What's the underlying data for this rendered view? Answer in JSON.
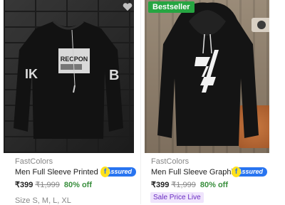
{
  "products": [
    {
      "brand": "FastColors",
      "title": "Men Full Sleeve Printed ...",
      "assured_label": "Assured",
      "price": "₹399",
      "mrp": "₹1,999",
      "discount": "80% off",
      "sizes": "Size S, M, L, XL",
      "print_text_1": "RECPON",
      "print_text_2": "IK",
      "print_text_3": "B"
    },
    {
      "badge": "Bestseller",
      "brand": "FastColors",
      "title": "Men Full Sleeve Graphic...",
      "assured_label": "Assured",
      "price": "₹399",
      "mrp": "₹1,999",
      "discount": "80% off",
      "sale_tag": "Sale Price Live"
    }
  ],
  "colors": {
    "badge_green": "#26a541",
    "assured_blue": "#2874f0",
    "discount_green": "#388e3c",
    "sale_purple": "#6b2ec3"
  }
}
